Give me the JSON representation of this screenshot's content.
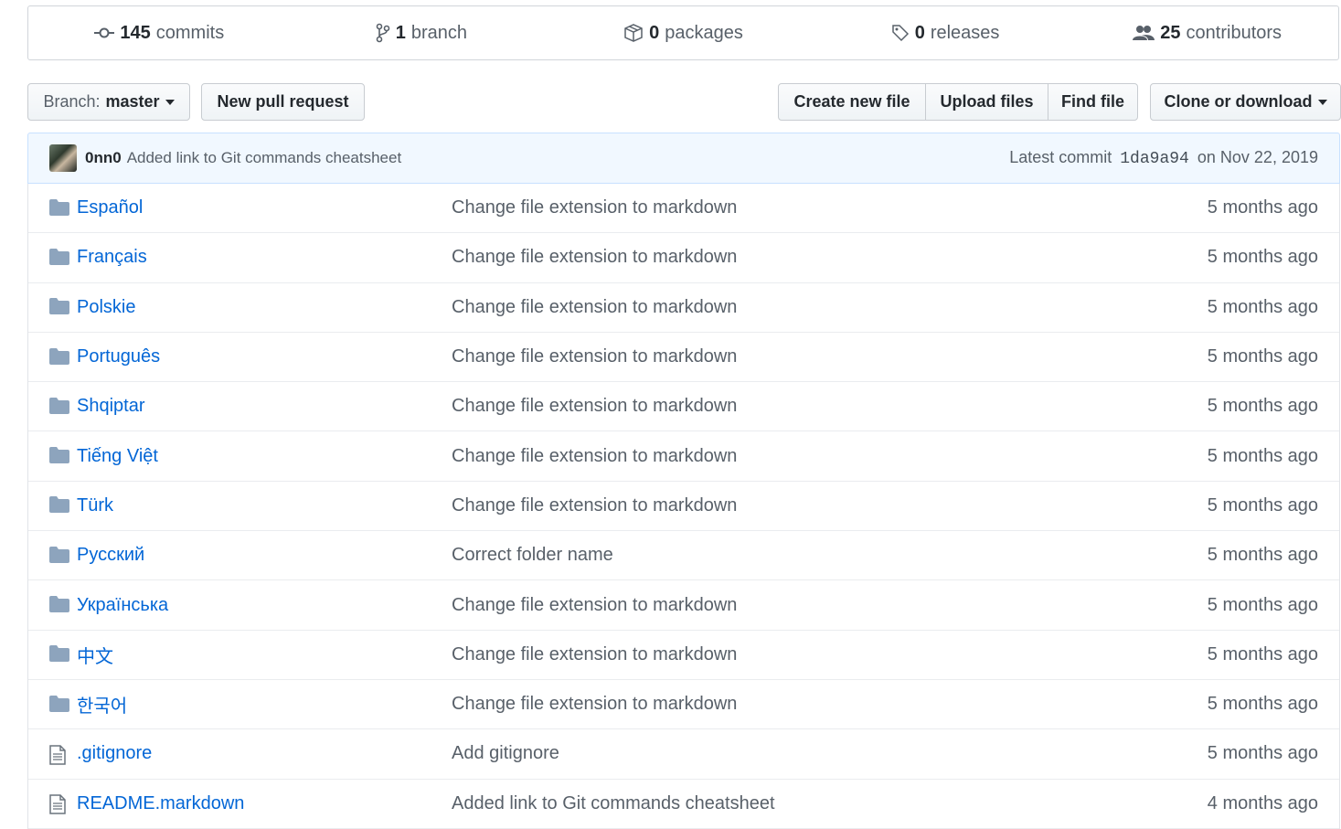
{
  "summary": {
    "commits": {
      "num": "145",
      "label": "commits"
    },
    "branches": {
      "num": "1",
      "label": "branch"
    },
    "packages": {
      "num": "0",
      "label": "packages"
    },
    "releases": {
      "num": "0",
      "label": "releases"
    },
    "contributors": {
      "num": "25",
      "label": "contributors"
    }
  },
  "toolbar": {
    "branch_label": "Branch:",
    "branch_value": "master",
    "new_pull_request": "New pull request",
    "create_new_file": "Create new file",
    "upload_files": "Upload files",
    "find_file": "Find file",
    "clone_or_download": "Clone or download"
  },
  "commit": {
    "author": "0nn0",
    "message": "Added link to Git commands cheatsheet",
    "latest_label": "Latest commit",
    "sha": "1da9a94",
    "date": "on Nov 22, 2019"
  },
  "files": [
    {
      "type": "folder",
      "name": "Español",
      "message": "Change file extension to markdown",
      "age": "5 months ago"
    },
    {
      "type": "folder",
      "name": "Français",
      "message": "Change file extension to markdown",
      "age": "5 months ago"
    },
    {
      "type": "folder",
      "name": "Polskie",
      "message": "Change file extension to markdown",
      "age": "5 months ago"
    },
    {
      "type": "folder",
      "name": "Português",
      "message": "Change file extension to markdown",
      "age": "5 months ago"
    },
    {
      "type": "folder",
      "name": "Shqiptar",
      "message": "Change file extension to markdown",
      "age": "5 months ago"
    },
    {
      "type": "folder",
      "name": "Tiếng Việt",
      "message": "Change file extension to markdown",
      "age": "5 months ago"
    },
    {
      "type": "folder",
      "name": "Türk",
      "message": "Change file extension to markdown",
      "age": "5 months ago"
    },
    {
      "type": "folder",
      "name": "Русский",
      "message": "Correct folder name",
      "age": "5 months ago"
    },
    {
      "type": "folder",
      "name": "Українська",
      "message": "Change file extension to markdown",
      "age": "5 months ago"
    },
    {
      "type": "folder",
      "name": "中文",
      "message": "Change file extension to markdown",
      "age": "5 months ago"
    },
    {
      "type": "folder",
      "name": "한국어",
      "message": "Change file extension to markdown",
      "age": "5 months ago"
    },
    {
      "type": "file",
      "name": ".gitignore",
      "message": "Add gitignore",
      "age": "5 months ago"
    },
    {
      "type": "file",
      "name": "README.markdown",
      "message": "Added link to Git commands cheatsheet",
      "age": "4 months ago"
    }
  ]
}
